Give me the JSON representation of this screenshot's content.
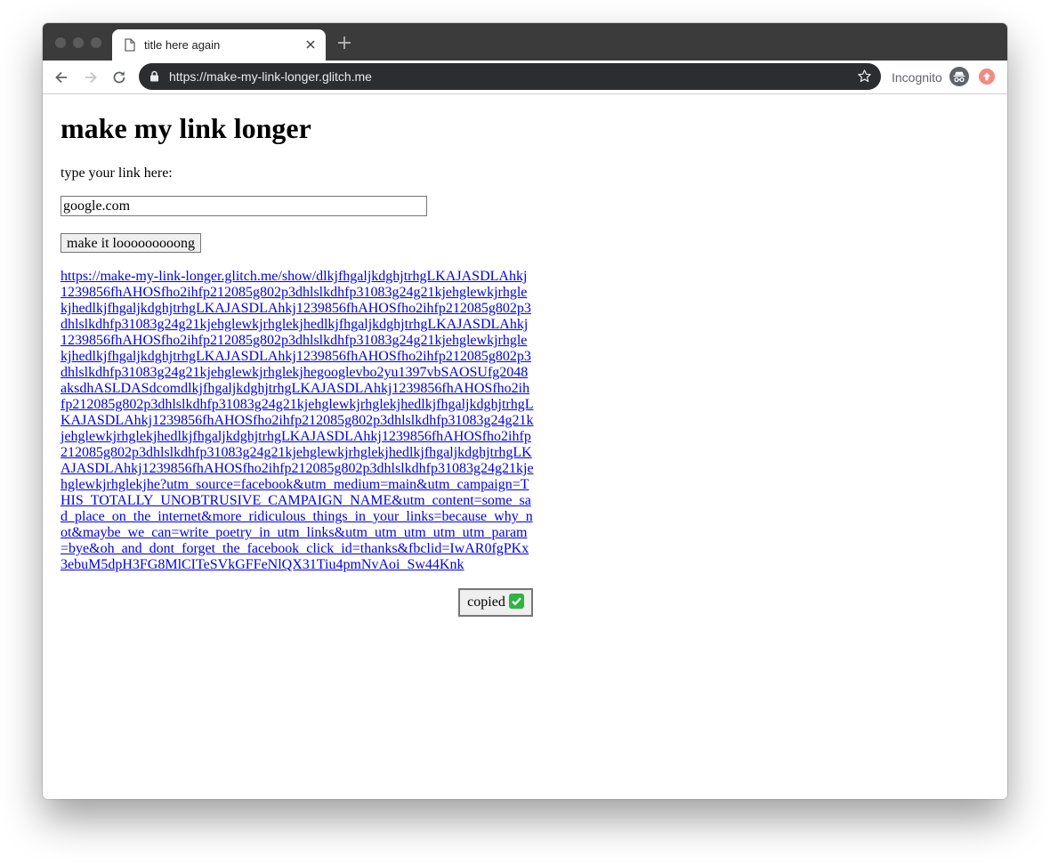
{
  "browser": {
    "tab_title": "title here again",
    "url": "https://make-my-link-longer.glitch.me",
    "profile_label": "Incognito",
    "icons": {
      "tab": "document-icon",
      "close": "close-icon",
      "new_tab": "plus-icon",
      "back": "back-arrow-icon",
      "forward": "forward-arrow-icon",
      "reload": "reload-icon",
      "lock": "lock-icon",
      "bookmark": "star-icon",
      "incognito": "incognito-icon",
      "update": "update-icon"
    }
  },
  "page": {
    "title": "make my link longer",
    "prompt": "type your link here:",
    "input_value": "google.com",
    "button_label": "make it looooooooong",
    "long_link": "https://make-my-link-longer.glitch.me/show/dlkjfhgaljkdghjtrhgLKAJASDLAhkj1239856fhAHOSfho2ihfp212085g802p3dhlslkdhfp31083g24g21kjehglewkjrhglekjhedlkjfhgaljkdghjtrhgLKAJASDLAhkj1239856fhAHOSfho2ihfp212085g802p3dhlslkdhfp31083g24g21kjehglewkjrhglekjhedlkjfhgaljkdghjtrhgLKAJASDLAhkj1239856fhAHOSfho2ihfp212085g802p3dhlslkdhfp31083g24g21kjehglewkjrhglekjhedlkjfhgaljkdghjtrhgLKAJASDLAhkj1239856fhAHOSfho2ihfp212085g802p3dhlslkdhfp31083g24g21kjehglewkjrhglekjhegooglevbo2yu1397vbSAOSUfg2048aksdhASLDASdcomdlkjfhgaljkdghjtrhgLKAJASDLAhkj1239856fhAHOSfho2ihfp212085g802p3dhlslkdhfp31083g24g21kjehglewkjrhglekjhedlkjfhgaljkdghjtrhgLKAJASDLAhkj1239856fhAHOSfho2ihfp212085g802p3dhlslkdhfp31083g24g21kjehglewkjrhglekjhedlkjfhgaljkdghjtrhgLKAJASDLAhkj1239856fhAHOSfho2ihfp212085g802p3dhlslkdhfp31083g24g21kjehglewkjrhglekjhedlkjfhgaljkdghjtrhgLKAJASDLAhkj1239856fhAHOSfho2ihfp212085g802p3dhlslkdhfp31083g24g21kjehglewkjrhglekjhe?utm_source=facebook&utm_medium=main&utm_campaign=THIS_TOTALLY_UNOBTRUSIVE_CAMPAIGN_NAME&utm_content=some_sad_place_on_the_internet&more_ridiculous_things_in_your_links=because_why_not&maybe_we_can=write_poetry_in_utm_links&utm_utm_utm_utm_utm_param=bye&oh_and_dont_forget_the_facebook_click_id=thanks&fbclid=IwAR0fgPKx3ebuM5dpH3FG8MlCITeSVkGFFeNlQX31Tiu4pmNvAoi_Sw44Knk",
    "copied_label": "copied",
    "copied_icon": "check-mark-icon"
  },
  "colors": {
    "link": "#0000ee",
    "titlebar": "#3b3b3b",
    "omnibox": "#2b2d31",
    "check": "#2fb344"
  }
}
